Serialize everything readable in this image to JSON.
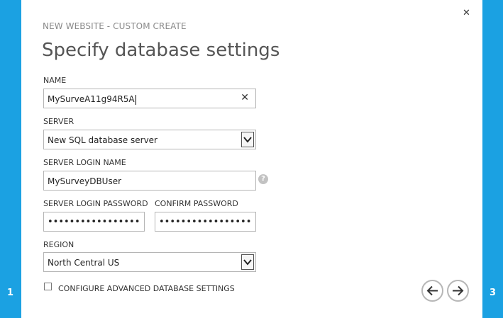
{
  "wizard": {
    "subtitle": "NEW WEBSITE - CUSTOM CREATE",
    "title": "Specify database settings",
    "step_previous": "1",
    "step_next": "3"
  },
  "form": {
    "name": {
      "label": "NAME",
      "value": "MySurveA11g94R5A"
    },
    "server": {
      "label": "SERVER",
      "value": "New SQL database server"
    },
    "login_name": {
      "label": "SERVER LOGIN NAME",
      "value": "MySurveyDBUser",
      "help": "?"
    },
    "login_password": {
      "label": "SERVER LOGIN PASSWORD",
      "value": "•••••••••••••••••"
    },
    "confirm_password": {
      "label": "CONFIRM PASSWORD",
      "value": "•••••••••••••••••"
    },
    "region": {
      "label": "REGION",
      "value": "North Central US"
    },
    "advanced": {
      "label": "CONFIGURE ADVANCED DATABASE SETTINGS",
      "checked": false
    }
  },
  "icons": {
    "close": "close-icon",
    "clear": "clear-icon",
    "dropdown": "chevron-down-icon",
    "back": "arrow-left-icon",
    "forward": "arrow-right-icon"
  },
  "colors": {
    "accent": "#1ba1e2"
  }
}
